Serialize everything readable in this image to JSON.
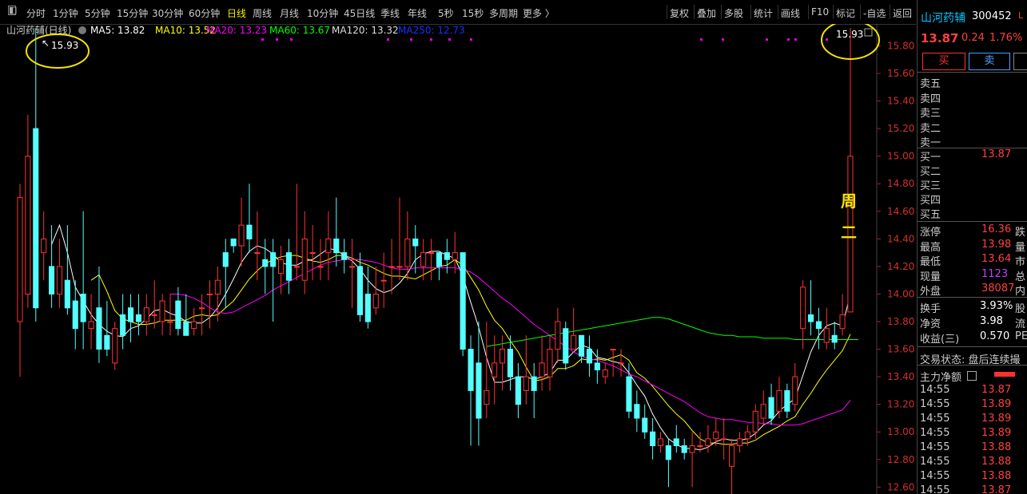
{
  "toolbar": {
    "left_icon": "panel-toggle-icon",
    "tabs": [
      "分时",
      "1分钟",
      "5分钟",
      "15分钟",
      "30分钟",
      "60分钟",
      "日线",
      "周线",
      "月线",
      "10分钟",
      "45日线",
      "季线",
      "年线",
      "5秒",
      "15秒",
      "多周期",
      "更多 〉"
    ],
    "active_tab": "日线",
    "right": [
      "复权",
      "叠加",
      "多股",
      "统计",
      "画线",
      "F10",
      "标记",
      "-自选",
      "返回"
    ]
  },
  "legend": {
    "name": "山河药辅(日线)",
    "ma": [
      {
        "label": "MA5: 13.82",
        "color": "#ffffff"
      },
      {
        "label": "MA10: 13.52",
        "color": "#ffff00"
      },
      {
        "label": "MA20: 13.23",
        "color": "#ff00ff"
      },
      {
        "label": "MA60: 13.67",
        "color": "#00ff00"
      },
      {
        "label": "MA120: 13.32",
        "color": "#dddddd"
      },
      {
        "label": "MA250: 12.73",
        "color": "#1530ff"
      }
    ]
  },
  "annotations": {
    "left_high": "15.93",
    "right_high": "15.93",
    "weekday_1": "周",
    "weekday_2": "二"
  },
  "chart_data": {
    "type": "candlestick",
    "y_ticks": [
      15.8,
      15.6,
      15.4,
      15.2,
      15.0,
      14.8,
      14.6,
      14.4,
      14.2,
      14.0,
      13.8,
      13.6,
      13.4,
      13.2,
      13.0,
      12.8,
      12.6
    ],
    "candles": [
      [
        13.8,
        14.7,
        14.8,
        13.4
      ],
      [
        14.0,
        15.0,
        15.3,
        13.9
      ],
      [
        15.2,
        13.9,
        15.93,
        13.8
      ],
      [
        14.3,
        14.4,
        14.6,
        14.1
      ],
      [
        14.2,
        14.0,
        14.5,
        13.9
      ],
      [
        14.0,
        14.2,
        14.4,
        13.9
      ],
      [
        14.1,
        13.9,
        14.5,
        13.85
      ],
      [
        13.95,
        13.75,
        14.1,
        13.6
      ],
      [
        14.0,
        13.8,
        14.6,
        13.6
      ],
      [
        13.75,
        13.8,
        14.0,
        13.6
      ],
      [
        13.9,
        13.6,
        14.2,
        13.5
      ],
      [
        13.7,
        13.6,
        13.95,
        13.55
      ],
      [
        13.5,
        13.75,
        13.8,
        13.45
      ],
      [
        13.85,
        13.7,
        14.0,
        13.6
      ],
      [
        13.9,
        13.8,
        14.0,
        13.65
      ],
      [
        13.85,
        13.8,
        14.0,
        13.7
      ],
      [
        13.8,
        13.9,
        14.0,
        13.7
      ],
      [
        13.85,
        13.85,
        14.1,
        13.75
      ],
      [
        13.8,
        13.95,
        14.0,
        13.7
      ],
      [
        13.8,
        13.8,
        14.0,
        13.7
      ],
      [
        13.95,
        13.75,
        14.05,
        13.7
      ],
      [
        13.8,
        13.7,
        14.0,
        13.7
      ],
      [
        13.75,
        13.8,
        13.9,
        13.7
      ],
      [
        13.9,
        13.9,
        14.0,
        13.7
      ],
      [
        14.0,
        14.0,
        14.1,
        13.75
      ],
      [
        14.0,
        14.1,
        14.2,
        13.8
      ],
      [
        14.3,
        14.2,
        14.4,
        13.9
      ],
      [
        14.4,
        14.35,
        14.4,
        14.3
      ],
      [
        14.35,
        14.5,
        14.7,
        14.2
      ],
      [
        14.5,
        14.4,
        14.8,
        14.3
      ],
      [
        14.3,
        14.3,
        14.6,
        14.1
      ],
      [
        14.25,
        14.2,
        14.4,
        14.0
      ],
      [
        14.3,
        14.2,
        14.4,
        13.8
      ],
      [
        14.15,
        14.25,
        14.35,
        14.0
      ],
      [
        14.3,
        14.1,
        14.4,
        14.0
      ],
      [
        14.2,
        14.2,
        14.8,
        14.1
      ],
      [
        14.1,
        14.4,
        14.6,
        14.0
      ],
      [
        14.3,
        14.3,
        14.5,
        14.1
      ],
      [
        14.2,
        14.2,
        14.4,
        14.1
      ],
      [
        14.3,
        14.4,
        14.6,
        14.1
      ],
      [
        14.4,
        14.3,
        14.7,
        14.2
      ],
      [
        14.3,
        14.25,
        14.4,
        14.15
      ],
      [
        14.2,
        14.2,
        14.4,
        13.9
      ],
      [
        14.2,
        13.85,
        14.3,
        13.8
      ],
      [
        14.0,
        13.8,
        14.2,
        13.75
      ],
      [
        13.9,
        14.0,
        14.2,
        13.85
      ],
      [
        14.1,
        14.1,
        14.3,
        13.9
      ],
      [
        14.2,
        14.2,
        14.4,
        14.0
      ],
      [
        14.2,
        14.2,
        14.7,
        14.1
      ],
      [
        14.2,
        14.4,
        14.6,
        14.1
      ],
      [
        14.4,
        14.35,
        14.5,
        14.15
      ],
      [
        14.2,
        14.3,
        14.4,
        14.1
      ],
      [
        14.3,
        14.3,
        14.4,
        14.1
      ],
      [
        14.3,
        14.2,
        14.3,
        14.1
      ],
      [
        14.3,
        14.25,
        14.4,
        14.15
      ],
      [
        14.25,
        14.3,
        14.45,
        14.15
      ],
      [
        14.3,
        13.6,
        14.3,
        13.55
      ],
      [
        13.6,
        13.3,
        13.7,
        12.9
      ],
      [
        13.5,
        13.1,
        13.8,
        12.9
      ],
      [
        13.2,
        13.3,
        13.8,
        13.1
      ],
      [
        13.4,
        13.5,
        13.7,
        13.2
      ],
      [
        13.5,
        13.6,
        13.7,
        13.3
      ],
      [
        13.6,
        13.4,
        13.7,
        13.3
      ],
      [
        13.4,
        13.2,
        13.5,
        13.1
      ],
      [
        13.3,
        13.4,
        13.7,
        13.2
      ],
      [
        13.4,
        13.3,
        13.5,
        13.1
      ],
      [
        13.4,
        13.5,
        13.7,
        13.3
      ],
      [
        13.4,
        13.6,
        13.7,
        13.3
      ],
      [
        13.6,
        13.8,
        13.9,
        13.5
      ],
      [
        13.75,
        13.5,
        13.8,
        13.45
      ],
      [
        13.6,
        13.7,
        13.9,
        13.6
      ],
      [
        13.7,
        13.55,
        13.7,
        13.5
      ],
      [
        13.6,
        13.5,
        13.7,
        13.4
      ],
      [
        13.5,
        13.45,
        13.6,
        13.35
      ],
      [
        13.4,
        13.45,
        13.5,
        13.35
      ],
      [
        13.6,
        13.6,
        13.6,
        13.4
      ],
      [
        13.5,
        13.5,
        13.6,
        13.4
      ],
      [
        13.4,
        13.15,
        13.5,
        13.1
      ],
      [
        13.2,
        13.1,
        13.3,
        13.0
      ],
      [
        13.1,
        13.0,
        13.2,
        12.95
      ],
      [
        13.0,
        12.9,
        13.1,
        12.8
      ],
      [
        12.9,
        12.95,
        13.0,
        12.85
      ],
      [
        12.9,
        12.8,
        12.95,
        12.6
      ],
      [
        12.95,
        12.9,
        13.05,
        12.85
      ],
      [
        12.9,
        12.85,
        12.95,
        12.8
      ],
      [
        12.85,
        12.9,
        13.0,
        12.6
      ],
      [
        12.9,
        12.9,
        13.0,
        12.85
      ],
      [
        12.9,
        12.95,
        13.05,
        12.85
      ],
      [
        12.95,
        13.0,
        13.1,
        12.9
      ],
      [
        12.95,
        12.95,
        13.1,
        12.8
      ],
      [
        12.75,
        12.9,
        12.95,
        12.55
      ],
      [
        12.9,
        12.95,
        13.0,
        12.85
      ],
      [
        12.95,
        13.0,
        13.05,
        12.9
      ],
      [
        13.0,
        13.15,
        13.2,
        12.95
      ],
      [
        13.1,
        13.2,
        13.3,
        13.05
      ],
      [
        13.25,
        13.1,
        13.35,
        13.05
      ],
      [
        13.15,
        13.3,
        13.4,
        13.1
      ],
      [
        13.3,
        13.15,
        13.35,
        13.1
      ],
      [
        13.2,
        13.4,
        13.5,
        13.15
      ],
      [
        13.75,
        14.05,
        14.1,
        13.6
      ],
      [
        13.85,
        13.8,
        14.1,
        13.7
      ],
      [
        13.8,
        13.75,
        13.9,
        13.6
      ],
      [
        13.65,
        13.75,
        13.9,
        13.6
      ],
      [
        13.7,
        13.65,
        13.8,
        13.6
      ],
      [
        13.75,
        13.85,
        14.0,
        13.7
      ],
      [
        13.87,
        15.0,
        15.93,
        13.87
      ]
    ],
    "ma_values": {
      "MA5": [
        null,
        null,
        null,
        null,
        14.36,
        14.5,
        14.3,
        14.05,
        13.95,
        13.85,
        13.78,
        13.73,
        13.7,
        13.69,
        13.75,
        13.77,
        13.82,
        13.88,
        13.89,
        13.86,
        13.84,
        13.8,
        13.79,
        13.79,
        13.83,
        13.9,
        14.0,
        14.11,
        14.23,
        14.31,
        14.35,
        14.33,
        14.29,
        14.23,
        14.21,
        14.21,
        14.24,
        14.25,
        14.29,
        14.33,
        14.32,
        14.28,
        14.24,
        14.18,
        14.1,
        14.04,
        14.01,
        14.03,
        14.08,
        14.15,
        14.25,
        14.29,
        14.31,
        14.31,
        14.28,
        14.26,
        14.13,
        13.94,
        13.76,
        13.54,
        13.36,
        13.36,
        13.38,
        13.4,
        13.4,
        13.38,
        13.4,
        13.43,
        13.52,
        13.52,
        13.58,
        13.63,
        13.61,
        13.54,
        13.53,
        13.51,
        13.5,
        13.43,
        13.34,
        13.26,
        13.13,
        13.03,
        12.95,
        12.91,
        12.88,
        12.88,
        12.87,
        12.89,
        12.93,
        12.95,
        12.94,
        12.94,
        12.95,
        12.99,
        13.05,
        13.08,
        13.15,
        13.2,
        13.24,
        13.41,
        13.58,
        13.7,
        13.77,
        13.79,
        13.77,
        14.0
      ],
      "MA10": [
        null,
        null,
        null,
        null,
        null,
        null,
        null,
        null,
        null,
        14.1,
        14.14,
        14.02,
        13.88,
        13.82,
        13.8,
        13.78,
        13.78,
        13.79,
        13.81,
        13.81,
        13.81,
        13.81,
        13.84,
        13.85,
        13.84,
        13.85,
        13.9,
        13.95,
        14.03,
        14.11,
        14.17,
        14.22,
        14.25,
        14.27,
        14.28,
        14.28,
        14.26,
        14.24,
        14.23,
        14.25,
        14.28,
        14.28,
        14.26,
        14.23,
        14.21,
        14.18,
        14.15,
        14.13,
        14.13,
        14.12,
        14.11,
        14.14,
        14.17,
        14.2,
        14.21,
        14.25,
        14.21,
        14.12,
        14.03,
        13.91,
        13.81,
        13.75,
        13.66,
        13.58,
        13.47,
        13.37,
        13.38,
        13.4,
        13.46,
        13.46,
        13.48,
        13.53,
        13.52,
        13.53,
        13.52,
        13.54,
        13.56,
        13.52,
        13.43,
        13.39,
        13.33,
        13.26,
        13.19,
        13.13,
        13.08,
        13.01,
        12.95,
        12.92,
        12.92,
        12.91,
        12.91,
        12.92,
        12.92,
        12.94,
        12.98,
        13.01,
        13.04,
        13.08,
        13.11,
        13.2,
        13.28,
        13.37,
        13.45,
        13.52,
        13.59,
        13.71
      ],
      "MA20": [
        null,
        null,
        null,
        null,
        null,
        null,
        null,
        null,
        null,
        null,
        null,
        null,
        null,
        null,
        null,
        null,
        null,
        null,
        null,
        14.0,
        14.0,
        13.99,
        13.97,
        13.94,
        13.9,
        13.87,
        13.86,
        13.87,
        13.9,
        13.93,
        13.96,
        13.99,
        14.03,
        14.06,
        14.09,
        14.12,
        14.15,
        14.18,
        14.21,
        14.23,
        14.24,
        14.25,
        14.25,
        14.25,
        14.24,
        14.23,
        14.21,
        14.19,
        14.18,
        14.18,
        14.19,
        14.19,
        14.19,
        14.19,
        14.19,
        14.19,
        14.18,
        14.16,
        14.12,
        14.07,
        14.02,
        13.97,
        13.93,
        13.88,
        13.83,
        13.78,
        13.74,
        13.7,
        13.66,
        13.62,
        13.58,
        13.55,
        13.53,
        13.52,
        13.5,
        13.48,
        13.45,
        13.42,
        13.4,
        13.37,
        13.34,
        13.31,
        13.28,
        13.25,
        13.22,
        13.18,
        13.14,
        13.11,
        13.1,
        13.09,
        13.09,
        13.08,
        13.07,
        13.07,
        13.06,
        13.06,
        13.05,
        13.05,
        13.05,
        13.06,
        13.08,
        13.1,
        13.12,
        13.14,
        13.16,
        13.23
      ],
      "MA60": [
        null,
        null,
        null,
        null,
        null,
        null,
        null,
        null,
        null,
        null,
        null,
        null,
        null,
        null,
        null,
        null,
        null,
        null,
        null,
        null,
        null,
        null,
        null,
        null,
        null,
        null,
        null,
        null,
        null,
        null,
        null,
        null,
        null,
        null,
        null,
        null,
        null,
        null,
        null,
        null,
        null,
        null,
        null,
        null,
        null,
        null,
        null,
        null,
        null,
        null,
        null,
        null,
        null,
        null,
        null,
        null,
        null,
        null,
        null,
        13.62,
        13.63,
        13.64,
        13.65,
        13.66,
        13.67,
        13.68,
        13.69,
        13.7,
        13.71,
        13.72,
        13.73,
        13.74,
        13.75,
        13.76,
        13.77,
        13.78,
        13.79,
        13.8,
        13.81,
        13.82,
        13.83,
        13.83,
        13.82,
        13.8,
        13.78,
        13.76,
        13.74,
        13.72,
        13.71,
        13.7,
        13.7,
        13.69,
        13.69,
        13.69,
        13.68,
        13.68,
        13.68,
        13.68,
        13.67,
        13.67,
        13.67,
        13.67,
        13.67,
        13.67,
        13.67,
        13.67,
        13.67
      ],
      "MA120": [
        null,
        null,
        null,
        null,
        null,
        null,
        null,
        null,
        null,
        null,
        null,
        null,
        null,
        null,
        null,
        null,
        null,
        null,
        null,
        null,
        null,
        null,
        null,
        null,
        null,
        null,
        null,
        null,
        null,
        null,
        null,
        null,
        null,
        null,
        null,
        null,
        null,
        null,
        null,
        null,
        null,
        null,
        null,
        null,
        null,
        null,
        null,
        null,
        null,
        null,
        null,
        null,
        null,
        null,
        null,
        null,
        null,
        null,
        null,
        null,
        null,
        null,
        null,
        null,
        null,
        null,
        null,
        null,
        null,
        null,
        null,
        null,
        null,
        null,
        null,
        null,
        null,
        null,
        null,
        null,
        null,
        null,
        null,
        null,
        null,
        null,
        null,
        null,
        null,
        null,
        null,
        null,
        null,
        null,
        null,
        null,
        null,
        null,
        null,
        null,
        null,
        null,
        null,
        null,
        null,
        null,
        null
      ],
      "MA250": []
    }
  },
  "quote": {
    "stock_name": "山河药辅",
    "stock_code": "300452",
    "code_suffix": "L",
    "price": "13.87",
    "change": "0.24",
    "change_pct": "1.76%",
    "buy_label": "买",
    "sell_label": "卖"
  },
  "order_book": {
    "sell": [
      "卖五",
      "卖四",
      "卖三",
      "卖二",
      "卖一"
    ],
    "buy": [
      {
        "label": "买一",
        "value": "13.87"
      },
      {
        "label": "买二",
        "value": ""
      },
      {
        "label": "买三",
        "value": ""
      },
      {
        "label": "买四",
        "value": ""
      },
      {
        "label": "买五",
        "value": ""
      }
    ]
  },
  "stats": [
    {
      "label": "涨停",
      "value": "16.36",
      "label2": "跌"
    },
    {
      "label": "最高",
      "value": "13.98",
      "label2": "量"
    },
    {
      "label": "最低",
      "value": "13.64",
      "label2": "市"
    },
    {
      "label": "现量",
      "value": "1123",
      "label2": "总"
    },
    {
      "label": "外盘",
      "value": "38087",
      "label2": "内"
    }
  ],
  "stats2": [
    {
      "label": "换手",
      "value": "3.93%",
      "label2": "股"
    },
    {
      "label": "净资",
      "value": "3.98",
      "label2": "流"
    },
    {
      "label": "收益(三)",
      "value": "0.570",
      "label2": "PE"
    }
  ],
  "trading_status": "交易状态: 盘后连续撮",
  "main_net_label": "主力净额",
  "ticks": [
    {
      "time": "14:55",
      "price": "13.87"
    },
    {
      "time": "14:55",
      "price": "13.89"
    },
    {
      "time": "14:55",
      "price": "13.89"
    },
    {
      "time": "14:55",
      "price": "13.89"
    },
    {
      "time": "14:55",
      "price": "13.88"
    },
    {
      "time": "14:55",
      "price": "13.88"
    },
    {
      "time": "14:55",
      "price": "13.88"
    },
    {
      "time": "14:55",
      "price": "13.87"
    }
  ]
}
